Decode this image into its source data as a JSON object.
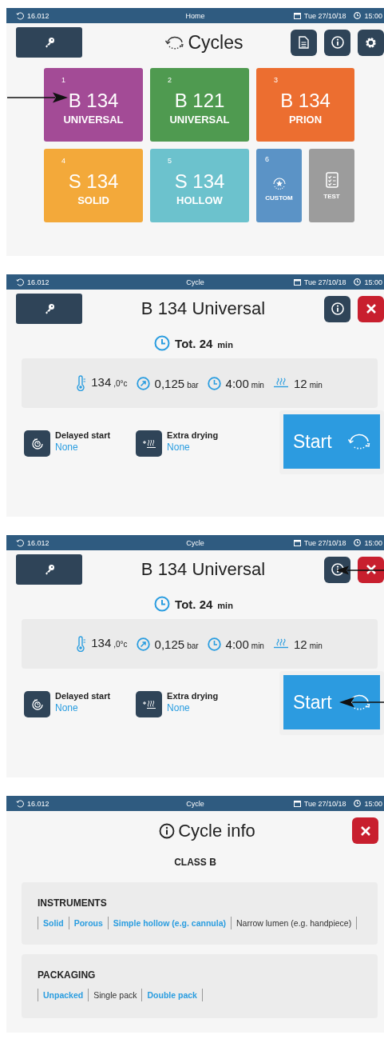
{
  "screens": [
    {
      "kind": "home",
      "status_bar": {
        "counter": "16.012",
        "title": "Home",
        "date": "Tue 27/10/18",
        "time": "15:00"
      },
      "title": "Cycles",
      "tiles": [
        {
          "kind": "cycle",
          "number": "1",
          "name": "B 134",
          "subtitle": "UNIVERSAL",
          "color": "#a34b96",
          "pointed": true
        },
        {
          "kind": "cycle",
          "number": "2",
          "name": "B 121",
          "subtitle": "UNIVERSAL",
          "color": "#4f9a50",
          "pointed": false
        },
        {
          "kind": "cycle",
          "number": "3",
          "name": "B 134",
          "subtitle": "PRION",
          "color": "#ec6e30",
          "pointed": false
        },
        {
          "kind": "cycle",
          "number": "4",
          "name": "S 134",
          "subtitle": "SOLID",
          "color": "#f3a93a",
          "pointed": false
        },
        {
          "kind": "cycle",
          "number": "5",
          "name": "S 134",
          "subtitle": "HOLLOW",
          "color": "#6cc2cd",
          "pointed": false
        },
        {
          "kind": "custom",
          "number": "6",
          "subtitle": "CUSTOM",
          "color": "#5b93c6",
          "pointed": false
        },
        {
          "kind": "test",
          "subtitle": "TEST",
          "color": "#9c9c9c",
          "pointed": false
        }
      ]
    },
    {
      "kind": "cycle",
      "status_bar": {
        "counter": "16.012",
        "title": "Cycle",
        "date": "Tue 27/10/18",
        "time": "15:00"
      },
      "title": "B 134 Universal",
      "info_button": {
        "pointed": false
      },
      "total": {
        "value": "Tot. 24",
        "unit": "min"
      },
      "params": [
        {
          "kind": "temperature",
          "value": "134",
          "unit": ",0°c"
        },
        {
          "kind": "pressure",
          "value": "0,125",
          "unit": "bar"
        },
        {
          "kind": "time",
          "value": "4:00",
          "unit": "min"
        },
        {
          "kind": "drying",
          "value": "12",
          "unit": "min"
        }
      ],
      "options": [
        {
          "kind": "delay",
          "label": "Delayed start",
          "value": "None"
        },
        {
          "kind": "drying",
          "label": "Extra drying",
          "value": "None"
        }
      ],
      "start_button": {
        "label": "Start",
        "pointed": false
      }
    },
    {
      "kind": "cycle",
      "status_bar": {
        "counter": "16.012",
        "title": "Cycle",
        "date": "Tue 27/10/18",
        "time": "15:00"
      },
      "title": "B 134 Universal",
      "info_button": {
        "pointed": true
      },
      "total": {
        "value": "Tot. 24",
        "unit": "min"
      },
      "params": [
        {
          "kind": "temperature",
          "value": "134",
          "unit": ",0°c"
        },
        {
          "kind": "pressure",
          "value": "0,125",
          "unit": "bar"
        },
        {
          "kind": "time",
          "value": "4:00",
          "unit": "min"
        },
        {
          "kind": "drying",
          "value": "12",
          "unit": "min"
        }
      ],
      "options": [
        {
          "kind": "delay",
          "label": "Delayed start",
          "value": "None"
        },
        {
          "kind": "drying",
          "label": "Extra drying",
          "value": "None"
        }
      ],
      "start_button": {
        "label": "Start",
        "pointed": true
      }
    },
    {
      "kind": "info",
      "status_bar": {
        "counter": "16.012",
        "title": "Cycle",
        "date": "Tue 27/10/18",
        "time": "15:00"
      },
      "title": "Cycle info",
      "class": "CLASS B",
      "sections": [
        {
          "heading": "INSTRUMENTS",
          "items": [
            {
              "label": "Solid",
              "selected": true
            },
            {
              "label": "Porous",
              "selected": true
            },
            {
              "label": "Simple hollow (e.g. cannula)",
              "selected": true
            },
            {
              "label": "Narrow lumen (e.g. handpiece)",
              "selected": false
            }
          ]
        },
        {
          "heading": "PACKAGING",
          "items": [
            {
              "label": "Unpacked",
              "selected": true
            },
            {
              "label": "Single pack",
              "selected": false
            },
            {
              "label": "Double pack",
              "selected": true
            }
          ]
        }
      ]
    }
  ]
}
